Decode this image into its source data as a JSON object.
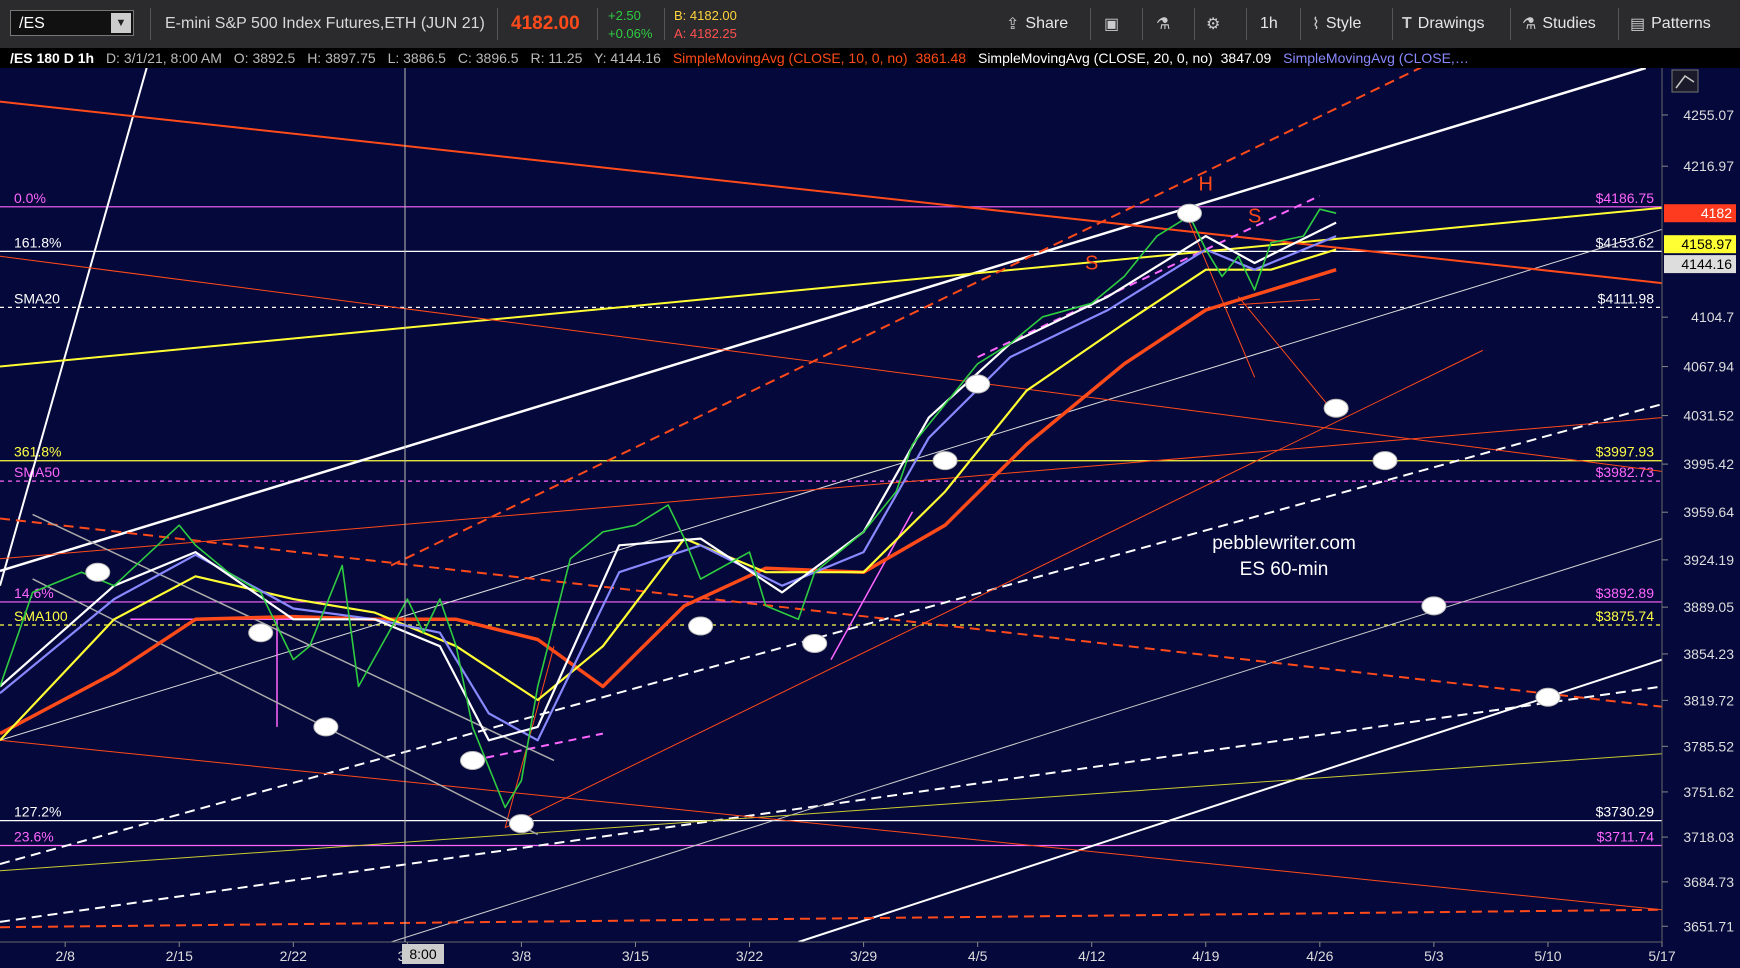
{
  "toolbar": {
    "symbol": "/ES",
    "description": "E-mini S&P 500 Index Futures,ETH (JUN 21)",
    "last_price": "4182.00",
    "change": "+2.50",
    "change_pct": "+0.06%",
    "bid": "B: 4182.00",
    "ask": "A: 4182.25",
    "share_label": "Share",
    "timeframe_label": "1h",
    "style_label": "Style",
    "drawings_label": "Drawings",
    "studies_label": "Studies",
    "patterns_label": "Patterns",
    "colors": {
      "up": "#2ecc40",
      "down": "#ff3030",
      "bid": "#ffd23a",
      "ask": "#ff5050"
    }
  },
  "infobar": {
    "symbol_tf": "/ES 180 D 1h",
    "date": "D: 3/1/21, 8:00 AM",
    "open": "O: 3892.5",
    "high": "H: 3897.75",
    "low": "L: 3886.5",
    "close": "C: 3896.5",
    "range": "R: 11.25",
    "y": "Y: 4144.16",
    "sma10": "SimpleMovingAvg (CLOSE, 10, 0, no)",
    "sma10_val": "3861.48",
    "sma20": "SimpleMovingAvg (CLOSE, 20, 0, no)",
    "sma20_val": "3847.09",
    "sma_more": "SimpleMovingAvg (CLOSE,…"
  },
  "chart_data": {
    "type": "line",
    "watermark": [
      "pebblewriter.com",
      "ES 60-min"
    ],
    "ylim": [
      3640,
      4290
    ],
    "xlim": [
      "2021-02-04",
      "2021-05-17"
    ],
    "y_ticks": [
      "4255.07",
      "4216.97",
      "4104.7",
      "4067.94",
      "4031.52",
      "3995.42",
      "3959.64",
      "3924.19",
      "3889.05",
      "3854.23",
      "3819.72",
      "3785.52",
      "3751.62",
      "3718.03",
      "3684.73",
      "3651.71"
    ],
    "x_ticks": [
      "2/8",
      "2/15",
      "2/22",
      "3/1",
      "3/8",
      "3/15",
      "3/22",
      "3/29",
      "4/5",
      "4/12",
      "4/19",
      "4/26",
      "5/3",
      "5/10",
      "5/17"
    ],
    "cursor_date_label": "8:00",
    "levels": [
      {
        "left_label": "0.0%",
        "right_label": "$4186.75",
        "value": 4186.75,
        "color": "#ff66ff",
        "dash": "solid"
      },
      {
        "left_label": "161.8%",
        "right_label": "$4153.62",
        "value": 4153.62,
        "color": "#ffffff",
        "dash": "solid"
      },
      {
        "left_label": "SMA20",
        "right_label": "$4111.98",
        "value": 4111.98,
        "color": "#ffffff",
        "dash": "dash"
      },
      {
        "left_label": "361.8%",
        "right_label": "$3997.93",
        "value": 3997.93,
        "color": "#ffff44",
        "dash": "solid"
      },
      {
        "left_label": "SMA50",
        "right_label": "$3982.73",
        "value": 3982.73,
        "color": "#ff66ff",
        "dash": "dash"
      },
      {
        "left_label": "14.6%",
        "right_label": "$3892.89",
        "value": 3892.89,
        "color": "#ff66ff",
        "dash": "solid"
      },
      {
        "left_label": "SMA100",
        "right_label": "$3875.74",
        "value": 3875.74,
        "color": "#ffff44",
        "dash": "dash"
      },
      {
        "left_label": "127.2%",
        "right_label": "$3730.29",
        "value": 3730.29,
        "color": "#ffffff",
        "dash": "solid"
      },
      {
        "left_label": "23.6%",
        "right_label": "$3711.74",
        "value": 3711.74,
        "color": "#ff66ff",
        "dash": "solid"
      }
    ],
    "price_tags": [
      {
        "label": "4182",
        "value": 4182,
        "bg": "#ff3b1f",
        "fg": "#ffffff"
      },
      {
        "label": "4158.97",
        "value": 4158.97,
        "bg": "#ffff33",
        "fg": "#000000"
      },
      {
        "label": "4144.16",
        "value": 4144.16,
        "bg": "#dddddd",
        "fg": "#000000"
      }
    ],
    "pattern_labels": [
      {
        "text": "S",
        "x": "2021-04-12",
        "y": 4140
      },
      {
        "text": "H",
        "x": "2021-04-19",
        "y": 4199
      },
      {
        "text": "S",
        "x": "2021-04-22",
        "y": 4175
      }
    ],
    "series": [
      {
        "name": "price",
        "color": "#2ecc40",
        "x": [
          "2021-02-04",
          "2021-02-06",
          "2021-02-09",
          "2021-02-11",
          "2021-02-15",
          "2021-02-16",
          "2021-02-18",
          "2021-02-20",
          "2021-02-22",
          "2021-02-23",
          "2021-02-25",
          "2021-02-26",
          "2021-03-01",
          "2021-03-02",
          "2021-03-03",
          "2021-03-04",
          "2021-03-05",
          "2021-03-07",
          "2021-03-08",
          "2021-03-09",
          "2021-03-11",
          "2021-03-13",
          "2021-03-15",
          "2021-03-17",
          "2021-03-18",
          "2021-03-19",
          "2021-03-22",
          "2021-03-23",
          "2021-03-25",
          "2021-03-26",
          "2021-03-29",
          "2021-03-31",
          "2021-04-01",
          "2021-04-03",
          "2021-04-05",
          "2021-04-07",
          "2021-04-09",
          "2021-04-12",
          "2021-04-14",
          "2021-04-16",
          "2021-04-18",
          "2021-04-19",
          "2021-04-20",
          "2021-04-21",
          "2021-04-22",
          "2021-04-23",
          "2021-04-25",
          "2021-04-26",
          "2021-04-27"
        ],
        "y": [
          3830,
          3900,
          3915,
          3905,
          3950,
          3935,
          3915,
          3900,
          3850,
          3860,
          3920,
          3830,
          3895,
          3870,
          3895,
          3860,
          3800,
          3740,
          3760,
          3830,
          3925,
          3945,
          3950,
          3965,
          3940,
          3910,
          3930,
          3890,
          3880,
          3915,
          3945,
          3975,
          4010,
          4040,
          4070,
          4085,
          4105,
          4115,
          4135,
          4165,
          4180,
          4155,
          4135,
          4150,
          4125,
          4160,
          4165,
          4185,
          4182
        ]
      },
      {
        "name": "SMA(CLOSE,10)",
        "color": "#ffffff",
        "x": [
          "2021-02-04",
          "2021-02-11",
          "2021-02-16",
          "2021-02-22",
          "2021-02-27",
          "2021-03-03",
          "2021-03-06",
          "2021-03-09",
          "2021-03-14",
          "2021-03-19",
          "2021-03-24",
          "2021-03-29",
          "2021-04-02",
          "2021-04-07",
          "2021-04-13",
          "2021-04-19",
          "2021-04-22",
          "2021-04-27"
        ],
        "y": [
          3830,
          3905,
          3930,
          3880,
          3880,
          3860,
          3790,
          3800,
          3935,
          3940,
          3900,
          3945,
          4030,
          4085,
          4120,
          4165,
          4145,
          4175
        ]
      },
      {
        "name": "SMA(CLOSE,20)",
        "color": "#8888ff",
        "x": [
          "2021-02-04",
          "2021-02-11",
          "2021-02-16",
          "2021-02-22",
          "2021-02-27",
          "2021-03-03",
          "2021-03-06",
          "2021-03-09",
          "2021-03-14",
          "2021-03-19",
          "2021-03-24",
          "2021-03-29",
          "2021-04-02",
          "2021-04-07",
          "2021-04-13",
          "2021-04-19",
          "2021-04-22",
          "2021-04-27"
        ],
        "y": [
          3825,
          3895,
          3928,
          3888,
          3880,
          3870,
          3810,
          3790,
          3915,
          3935,
          3905,
          3930,
          4015,
          4075,
          4110,
          4155,
          4140,
          4165
        ]
      },
      {
        "name": "SMA(CLOSE,50)",
        "color": "#ffff33",
        "x": [
          "2021-02-04",
          "2021-02-11",
          "2021-02-16",
          "2021-02-22",
          "2021-02-27",
          "2021-03-04",
          "2021-03-09",
          "2021-03-13",
          "2021-03-18",
          "2021-03-23",
          "2021-03-29",
          "2021-04-03",
          "2021-04-08",
          "2021-04-14",
          "2021-04-19",
          "2021-04-23",
          "2021-04-27"
        ],
        "y": [
          3790,
          3880,
          3912,
          3895,
          3885,
          3860,
          3820,
          3860,
          3940,
          3915,
          3915,
          3975,
          4050,
          4100,
          4140,
          4140,
          4155
        ]
      },
      {
        "name": "SMA(CLOSE,100)",
        "color": "#ff4a1a",
        "x": [
          "2021-02-04",
          "2021-02-11",
          "2021-02-16",
          "2021-02-22",
          "2021-02-27",
          "2021-03-04",
          "2021-03-09",
          "2021-03-13",
          "2021-03-18",
          "2021-03-23",
          "2021-03-29",
          "2021-04-03",
          "2021-04-08",
          "2021-04-14",
          "2021-04-19",
          "2021-04-23",
          "2021-04-27"
        ],
        "y": [
          3795,
          3840,
          3880,
          3882,
          3880,
          3880,
          3865,
          3830,
          3890,
          3918,
          3915,
          3950,
          4010,
          4070,
          4110,
          4125,
          4140
        ]
      }
    ],
    "trendlines": [
      {
        "color": "#ffffff",
        "width": 2.5,
        "dash": "",
        "x": [
          "2021-02-04",
          "2021-05-16"
        ],
        "y": [
          3916,
          4290
        ]
      },
      {
        "color": "#ffffff",
        "width": 2,
        "dash": "",
        "x": [
          "2021-02-04",
          "2021-02-13"
        ],
        "y": [
          3905,
          4290
        ]
      },
      {
        "color": "#ffffff",
        "width": 2,
        "dash": "",
        "x": [
          "2021-03-25",
          "2021-05-17"
        ],
        "y": [
          3640,
          3850
        ]
      },
      {
        "color": "#ffffff",
        "width": 2,
        "dash": "10 6",
        "x": [
          "2021-02-04",
          "2021-05-17"
        ],
        "y": [
          3698,
          4040
        ]
      },
      {
        "color": "#ffffff",
        "width": 2,
        "dash": "10 6",
        "x": [
          "2021-02-04",
          "2021-05-17"
        ],
        "y": [
          3655,
          3830
        ]
      },
      {
        "color": "#dddddd",
        "width": 1,
        "dash": "",
        "x": [
          "2021-02-04",
          "2021-05-17"
        ],
        "y": [
          3790,
          4170
        ]
      },
      {
        "color": "#cccccc",
        "width": 1,
        "dash": "",
        "x": [
          "2021-02-28",
          "2021-05-17"
        ],
        "y": [
          3640,
          3940
        ]
      },
      {
        "color": "#ffff33",
        "width": 2,
        "dash": "",
        "x": [
          "2021-02-04",
          "2021-05-17"
        ],
        "y": [
          4068,
          4186
        ]
      },
      {
        "color": "#cccc33",
        "width": 1,
        "dash": "",
        "x": [
          "2021-02-04",
          "2021-05-17"
        ],
        "y": [
          3693,
          3780
        ]
      },
      {
        "color": "#ff4a1a",
        "width": 2,
        "dash": "",
        "x": [
          "2021-02-04",
          "2021-05-17"
        ],
        "y": [
          4265,
          4130
        ]
      },
      {
        "color": "#ff4a1a",
        "width": 2,
        "dash": "10 6",
        "x": [
          "2021-02-04",
          "2021-05-17"
        ],
        "y": [
          3955,
          3815
        ]
      },
      {
        "color": "#ff4a1a",
        "width": 2,
        "dash": "10 6",
        "x": [
          "2021-02-04",
          "2021-05-17"
        ],
        "y": [
          3651,
          3664
        ]
      },
      {
        "color": "#ff4a1a",
        "width": 2,
        "dash": "10 6",
        "x": [
          "2021-02-28",
          "2021-05-03"
        ],
        "y": [
          3920,
          4295
        ]
      },
      {
        "color": "#ff4a1a",
        "width": 1,
        "dash": "",
        "x": [
          "2021-02-04",
          "2021-05-17"
        ],
        "y": [
          4150,
          3990
        ]
      },
      {
        "color": "#ff4a1a",
        "width": 1,
        "dash": "",
        "x": [
          "2021-02-04",
          "2021-05-17"
        ],
        "y": [
          3790,
          3664
        ]
      },
      {
        "color": "#ff4a1a",
        "width": 1,
        "dash": "",
        "x": [
          "2021-02-04",
          "2021-05-17"
        ],
        "y": [
          3925,
          4030
        ]
      },
      {
        "color": "#ff4a1a",
        "width": 1,
        "dash": "",
        "x": [
          "2021-03-07",
          "2021-05-06"
        ],
        "y": [
          3725,
          4080
        ]
      },
      {
        "color": "#ff4a1a",
        "width": 1,
        "dash": "",
        "x": [
          "2021-04-21",
          "2021-04-27"
        ],
        "y": [
          4120,
          4032
        ]
      },
      {
        "color": "#ff4a1a",
        "width": 1,
        "dash": "",
        "x": [
          "2021-04-18",
          "2021-04-22"
        ],
        "y": [
          4175,
          4060
        ]
      },
      {
        "color": "#ff4a1a",
        "width": 1,
        "dash": "",
        "x": [
          "2021-04-21",
          "2021-04-26"
        ],
        "y": [
          4114,
          4118
        ]
      },
      {
        "color": "#ff4a1a",
        "width": 1,
        "dash": "",
        "x": [
          "2021-03-07",
          "2021-03-10"
        ],
        "y": [
          3725,
          3860
        ]
      },
      {
        "color": "#ff66ff",
        "width": 2,
        "dash": "8 6",
        "x": [
          "2021-04-05",
          "2021-04-26"
        ],
        "y": [
          4075,
          4195
        ]
      },
      {
        "color": "#ff66ff",
        "width": 2,
        "dash": "8 6",
        "x": [
          "2021-03-05",
          "2021-03-13"
        ],
        "y": [
          3775,
          3795
        ]
      },
      {
        "color": "#ff66ff",
        "width": 1.5,
        "dash": "",
        "x": [
          "2021-03-27",
          "2021-04-01"
        ],
        "y": [
          3850,
          3960
        ]
      },
      {
        "color": "#ff66ff",
        "width": 1.5,
        "dash": "",
        "x": [
          "2021-02-12",
          "2021-02-24"
        ],
        "y": [
          3880,
          3880
        ]
      },
      {
        "color": "#ff66ff",
        "width": 1.5,
        "dash": "",
        "x": [
          "2021-02-21",
          "2021-02-21"
        ],
        "y": [
          3880,
          3800
        ]
      },
      {
        "color": "#aaaaaa",
        "width": 1.5,
        "dash": "",
        "x": [
          "2021-02-06",
          "2021-03-10"
        ],
        "y": [
          3958,
          3775
        ]
      },
      {
        "color": "#aaaaaa",
        "width": 1.5,
        "dash": "",
        "x": [
          "2021-02-06",
          "2021-03-09"
        ],
        "y": [
          3910,
          3720
        ]
      }
    ],
    "markers": [
      {
        "x": "2021-02-10",
        "y": 3915
      },
      {
        "x": "2021-02-20",
        "y": 3870
      },
      {
        "x": "2021-02-24",
        "y": 3800
      },
      {
        "x": "2021-03-05",
        "y": 3775
      },
      {
        "x": "2021-03-08",
        "y": 3728
      },
      {
        "x": "2021-03-19",
        "y": 3875
      },
      {
        "x": "2021-03-26",
        "y": 3862
      },
      {
        "x": "2021-04-03",
        "y": 3998
      },
      {
        "x": "2021-04-05",
        "y": 4055
      },
      {
        "x": "2021-04-18",
        "y": 4182
      },
      {
        "x": "2021-04-27",
        "y": 4037
      },
      {
        "x": "2021-04-30",
        "y": 3998
      },
      {
        "x": "2021-05-03",
        "y": 3890
      },
      {
        "x": "2021-05-10",
        "y": 3822
      }
    ]
  }
}
